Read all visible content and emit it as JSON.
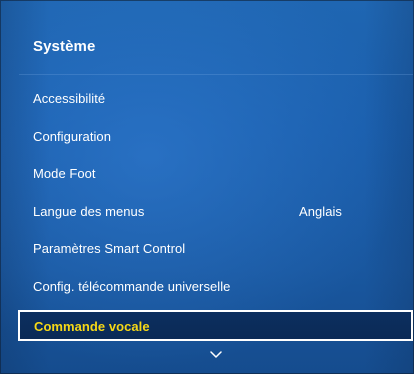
{
  "menu": {
    "title": "Système",
    "items": [
      {
        "label": "Accessibilité",
        "value": ""
      },
      {
        "label": "Configuration",
        "value": ""
      },
      {
        "label": "Mode Foot",
        "value": ""
      },
      {
        "label": "Langue des menus",
        "value": "Anglais"
      },
      {
        "label": "Paramètres Smart Control",
        "value": ""
      },
      {
        "label": "Config. télécommande universelle",
        "value": ""
      },
      {
        "label": "Commande vocale",
        "value": ""
      }
    ],
    "selected_index": 6
  },
  "icons": {
    "scroll_down": "chevron-down-icon"
  },
  "colors": {
    "background": "#1b5ea9",
    "selected_background": "#0b2c5a",
    "selected_text": "#f6d816",
    "selected_border": "#ffffff",
    "text": "#ffffff"
  }
}
